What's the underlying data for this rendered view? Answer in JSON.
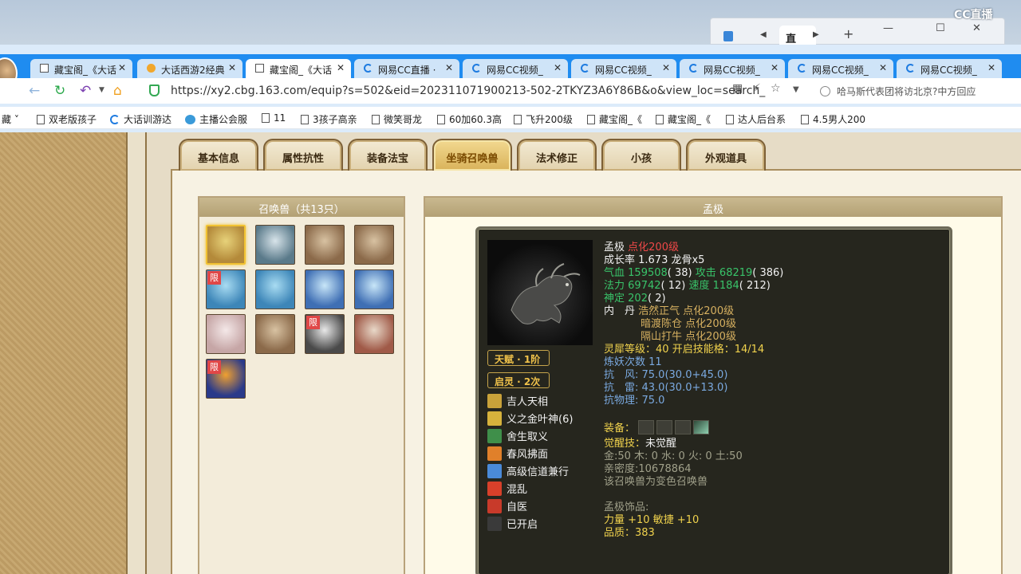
{
  "mini_window": {
    "tab_text": "直"
  },
  "overlay": {
    "logo_text": "CC直播"
  },
  "browser": {
    "tabs": [
      {
        "label": "藏宝阁_《大话",
        "icon": "doc"
      },
      {
        "label": "大话西游2经典",
        "icon": "game"
      },
      {
        "label": "藏宝阁_《大话",
        "icon": "doc"
      },
      {
        "label": "网易CC直播 ·",
        "icon": "ring"
      },
      {
        "label": "网易CC视频_",
        "icon": "ring"
      },
      {
        "label": "网易CC视频_",
        "icon": "ring"
      },
      {
        "label": "网易CC视频_",
        "icon": "ring"
      },
      {
        "label": "网易CC视频_",
        "icon": "ring"
      },
      {
        "label": "网易CC视频_",
        "icon": "ring"
      }
    ],
    "url": "https://xy2.cbg.163.com/equip?s=502&eid=202311071900213-502-2TKYZ3A6Y86B&o&view_loc=search_",
    "news_text": "哈马斯代表团将访北京?中方回应",
    "bookmarks": [
      {
        "label": "藏 ˅",
        "icon": "none"
      },
      {
        "label": "双老版孩子",
        "icon": "doc"
      },
      {
        "label": "大话训游达",
        "icon": "ring"
      },
      {
        "label": "主播公会服",
        "icon": "host"
      },
      {
        "label": "11",
        "icon": "doc"
      },
      {
        "label": "3孩子高亲",
        "icon": "doc"
      },
      {
        "label": "微笑哥龙",
        "icon": "doc"
      },
      {
        "label": "60加60.3高",
        "icon": "doc"
      },
      {
        "label": "飞升200级",
        "icon": "doc"
      },
      {
        "label": "藏宝阁_《",
        "icon": "doc"
      },
      {
        "label": "藏宝阁_《",
        "icon": "doc"
      },
      {
        "label": "达人后台系",
        "icon": "doc"
      },
      {
        "label": "4.5男人200",
        "icon": "doc"
      }
    ]
  },
  "game": {
    "tabs": [
      "基本信息",
      "属性抗性",
      "装备法宝",
      "坐骑召唤兽",
      "法术修正",
      "小孩",
      "外观道具"
    ],
    "active_tab": 3,
    "summon_panel_title": "召唤兽（共13只）",
    "pets": [
      {
        "name": "pet-1",
        "limited": false,
        "color": "#b48a3a",
        "accent": "#e7d27a"
      },
      {
        "name": "pet-2",
        "limited": false,
        "color": "#5a7a8a",
        "accent": "#d8e4ea"
      },
      {
        "name": "pet-3",
        "limited": false,
        "color": "#8b6a4a",
        "accent": "#d8c2a2"
      },
      {
        "name": "pet-4",
        "limited": false,
        "color": "#8b6a4a",
        "accent": "#d8c2a2"
      },
      {
        "name": "pet-5",
        "limited": true,
        "color": "#3d86b8",
        "accent": "#a9dcf2"
      },
      {
        "name": "pet-6",
        "limited": false,
        "color": "#3d86b8",
        "accent": "#a9dcf2"
      },
      {
        "name": "pet-7",
        "limited": false,
        "color": "#3f6fb4",
        "accent": "#c8e6f8"
      },
      {
        "name": "pet-8",
        "limited": false,
        "color": "#3f6fb4",
        "accent": "#c8e6f8"
      },
      {
        "name": "pet-9",
        "limited": false,
        "color": "#c6a6a6",
        "accent": "#f4e8e8"
      },
      {
        "name": "pet-10",
        "limited": false,
        "color": "#8b6a4a",
        "accent": "#d8c2a2"
      },
      {
        "name": "pet-11",
        "limited": true,
        "color": "#4a4a4a",
        "accent": "#e8e8e8"
      },
      {
        "name": "pet-12",
        "limited": false,
        "color": "#a05a48",
        "accent": "#e8d8c8"
      },
      {
        "name": "pet-13",
        "limited": true,
        "color": "#2a3a8a",
        "accent": "#f0a030"
      }
    ],
    "detail_title": "孟极",
    "badges": [
      "天赋 · 1阶",
      "启灵 · 2次"
    ],
    "skills": [
      {
        "label": "吉人天相",
        "color": "#c9a23a"
      },
      {
        "label": "义之金叶神(6)",
        "color": "#d6b23c"
      },
      {
        "label": "舍生取义",
        "color": "#3f8f4a"
      },
      {
        "label": "春风拂面",
        "color": "#e0802a"
      },
      {
        "label": "高级信道兼行",
        "color": "#4a8ad8"
      },
      {
        "label": "混乱",
        "color": "#d8402a"
      },
      {
        "label": "自医",
        "color": "#c83a2a"
      },
      {
        "label": "已开启",
        "color": "#3a3a3a"
      }
    ],
    "stats": {
      "name": "孟极",
      "name_level": "点化200级",
      "growth": "成长率 1.673 龙骨x5",
      "hp_label": "气血",
      "hp_value": "159508",
      "hp_pts": "( 38)",
      "atk_label": "攻击",
      "atk_value": "68219",
      "atk_pts": "( 386)",
      "mp_label": "法力",
      "mp_value": "69742",
      "mp_pts": "( 12)",
      "spd_label": "速度",
      "spd_value": "1184",
      "spd_pts": "( 212)",
      "focus_label": "神定",
      "focus_value": "202",
      "focus_pts": "( 2)",
      "neidan_label": "内　丹",
      "neidan": [
        "浩然正气 点化200级",
        "暗渡陈仓 点化200级",
        "隔山打牛 点化200级"
      ],
      "spirit_label": "灵犀等级：",
      "spirit_value": "40",
      "spirit_skill_label": " 开启技能格：",
      "spirit_skill_value": "14/14",
      "refine": "炼妖次数 11",
      "resist_wind": "抗　风: 75.0(30.0+45.0)",
      "resist_thunder": "抗　雷: 43.0(30.0+13.0)",
      "resist_phys": "抗物理: 75.0",
      "equip_label": "装备：",
      "awaken_label": "觉醒技：",
      "awaken_value": "未觉醒",
      "elements": "金:50 木: 0 水: 0 火: 0 土:50",
      "intimacy": "亲密度:10678864",
      "variant": "该召唤兽为变色召唤兽",
      "ornament_title": "孟极饰品:",
      "ornament_stats": "力量 +10 敏捷 +10",
      "ornament_quality": "品质：383"
    }
  }
}
